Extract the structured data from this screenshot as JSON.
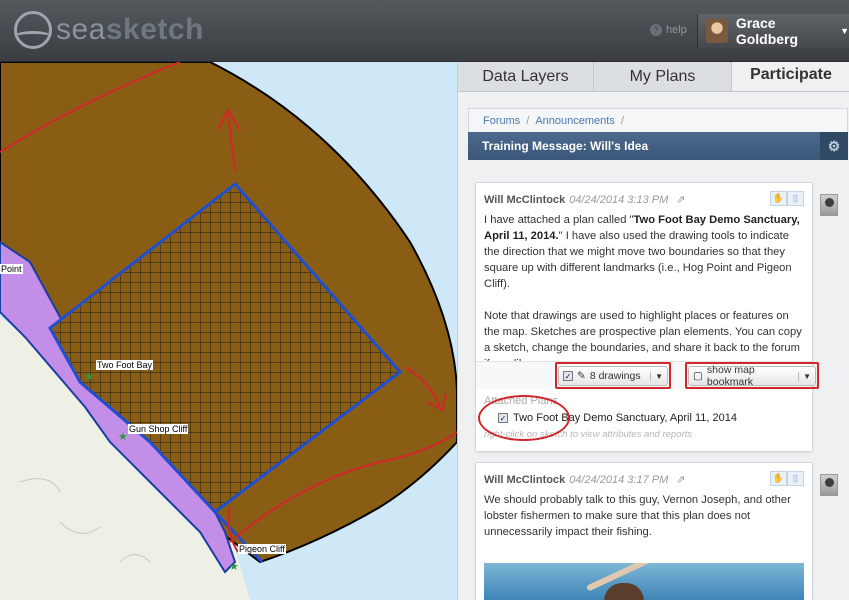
{
  "app": {
    "logo_bold": "sea",
    "logo_rest": "sketch"
  },
  "header": {
    "help_label": "help",
    "user_name": "Grace Goldberg"
  },
  "tabs": [
    {
      "label": "Data Layers"
    },
    {
      "label": "My Plans"
    },
    {
      "label": "Participate"
    }
  ],
  "breadcrumb": {
    "items": [
      "Forums",
      "Announcements"
    ]
  },
  "thread": {
    "title": "Training Message: Will's Idea"
  },
  "posts": [
    {
      "author": "Will McClintock",
      "date": "04/24/2014 3:13 PM",
      "body_1a": "I have attached a plan called \"",
      "body_1b": "Two Foot Bay Demo Sanctuary, April 11, 2014.",
      "body_1c": "\" I have also used the drawing tools to indicate the direction that we might move two boundaries so that they square up with different landmarks (i.e., Hog Point and Pigeon Cliff).",
      "body_2": "Note that drawings are used to highlight places or features on the map. Sketches are prospective plan elements. You can copy a sketch, change the boundaries, and share it back to the forum if you like.",
      "drawings_label": "8 drawings",
      "bookmark_label": "show map bookmark",
      "attached_title": "Attached Plans",
      "attached_plan": "Two Foot Bay Demo Sanctuary, April 11, 2014",
      "attached_hint": "right-click on sketch to view attributes and reports"
    },
    {
      "author": "Will McClintock",
      "date": "04/24/2014 3:17 PM",
      "body": "We should probably talk to this guy, Vernon Joseph, and other lobster fishermen to make sure that this plan does not unnecessarily impact their fishing."
    }
  ],
  "map": {
    "labels": {
      "hog_point": "Point",
      "two_foot_bay": "Two Foot Bay",
      "gun_shop_cliff": "Gun Shop Cliff",
      "pigeon_cliff": "Pigeon Cliff"
    }
  },
  "colors": {
    "ocean": "#cfe8f7",
    "zone_brown": "#8a5d14",
    "sanctuary_border": "#1f4fd1",
    "annotation_red": "#d1262a"
  }
}
